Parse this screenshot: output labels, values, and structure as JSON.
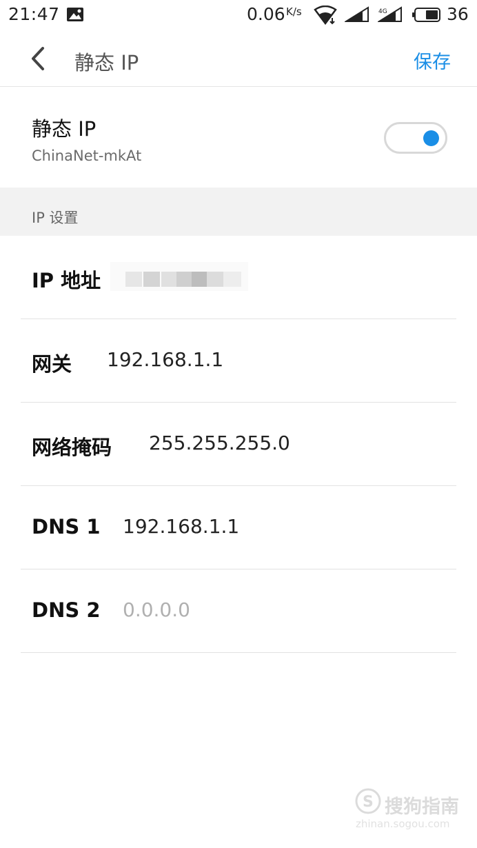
{
  "status_bar": {
    "time": "21:47",
    "speed": "0.06",
    "speed_unit": "K/s",
    "battery": "36"
  },
  "header": {
    "title": "静态 IP",
    "save_label": "保存"
  },
  "static_ip": {
    "title": "静态 IP",
    "network_name": "ChinaNet-mkAt",
    "enabled": true
  },
  "section": {
    "title": "IP 设置"
  },
  "fields": {
    "ip_address": {
      "label": "IP 地址",
      "value": ""
    },
    "gateway": {
      "label": "网关",
      "value": "192.168.1.1"
    },
    "netmask": {
      "label": "网络掩码",
      "value": "255.255.255.0"
    },
    "dns1": {
      "label": "DNS 1",
      "value": "192.168.1.1"
    },
    "dns2": {
      "label": "DNS 2",
      "placeholder": "0.0.0.0"
    }
  },
  "colors": {
    "accent": "#1a8ee6",
    "section_bg": "#f2f2f2"
  },
  "watermark": {
    "text": "搜狗指南",
    "sub": "zhinan.sogou.com"
  }
}
